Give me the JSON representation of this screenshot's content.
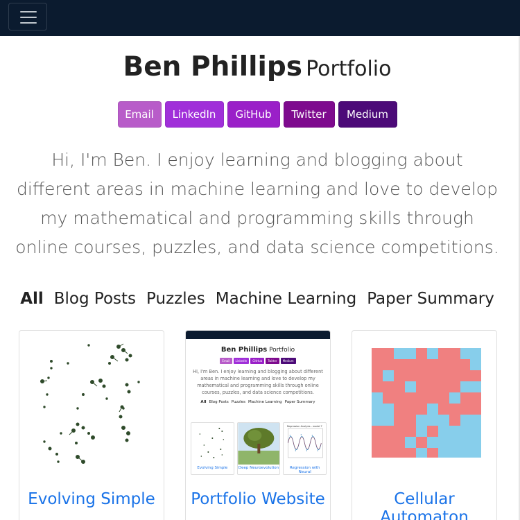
{
  "header": {
    "name": "Ben Phillips",
    "subtitle": "Portfolio"
  },
  "social": [
    {
      "label": "Email",
      "color": "#b85cc9"
    },
    {
      "label": "LinkedIn",
      "color": "#a02fd9"
    },
    {
      "label": "GitHub",
      "color": "#9a20c8"
    },
    {
      "label": "Twitter",
      "color": "#7e0a8e"
    },
    {
      "label": "Medium",
      "color": "#4c0a78"
    }
  ],
  "intro": "Hi, I'm Ben. I enjoy learning and blogging about different areas in machine learning and love to develop my mathematical and programming skills through online courses, puzzles, and data science competitions.",
  "filters": [
    "All",
    "Blog Posts",
    "Puzzles",
    "Machine Learning",
    "Paper Summary"
  ],
  "cards": [
    {
      "title": "Evolving Simple"
    },
    {
      "title": "Portfolio Website"
    },
    {
      "title": "Cellular Automaton"
    }
  ],
  "thumbnail": {
    "name": "Ben Phillips",
    "subtitle": "Portfolio",
    "buttons": [
      "Email",
      "LinkedIn",
      "GitHub",
      "Twitter",
      "Medium"
    ],
    "intro": "Hi, I'm Ben. I enjoy learning and blogging about different areas in machine learning and love to develop my mathematical and programming skills through online courses, puzzles, and data science competitions.",
    "filters": [
      "All",
      "Blog Posts",
      "Puzzles",
      "Machine Learning",
      "Paper Summary"
    ],
    "cards": [
      "Evolving Simple",
      "Deep Neuroevolution",
      "Regression with Neural"
    ],
    "chart_title": "Regression Analysis - model 7"
  },
  "colors": {
    "navbar": "#0b1b2f",
    "link": "#1a73e8",
    "automaton_red": "#f08080",
    "automaton_blue": "#87ceeb"
  }
}
